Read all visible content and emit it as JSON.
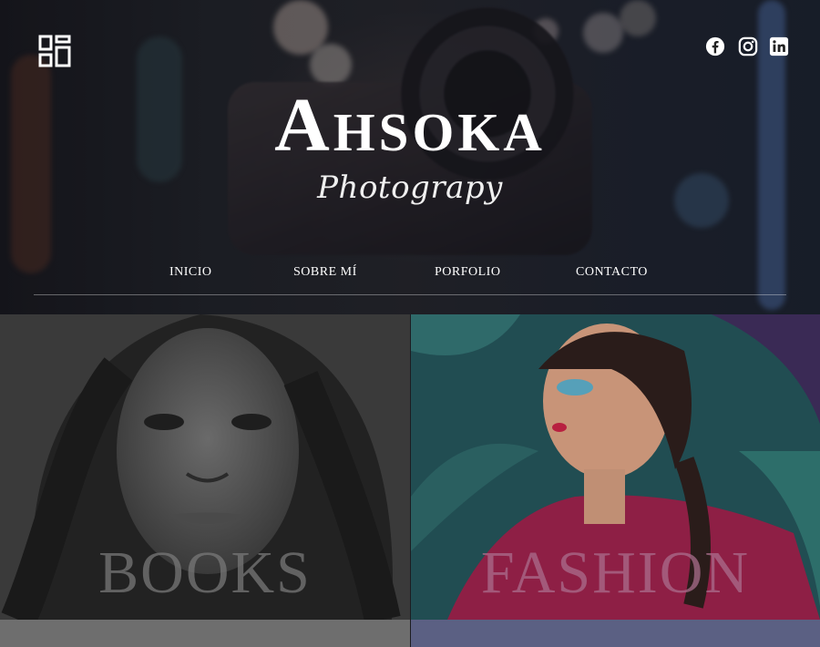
{
  "header": {
    "brand_title": "Ahsoka",
    "brand_subtitle": "Photograpy",
    "menu_icon": "grid-menu-icon",
    "social_icons": [
      "facebook-icon",
      "instagram-icon",
      "linkedin-icon"
    ]
  },
  "nav": {
    "items": [
      {
        "label": "INICIO"
      },
      {
        "label": "SOBRE MÍ"
      },
      {
        "label": "PORFOLIO"
      },
      {
        "label": "CONTACTO"
      }
    ]
  },
  "gallery": {
    "tiles": [
      {
        "label": "BOOKS"
      },
      {
        "label": "FASHION"
      }
    ]
  },
  "colors": {
    "hero_overlay": "#1c1d22",
    "text": "#ffffff",
    "books_strip": "#6e6e6e",
    "fashion_strip": "#5b6083"
  }
}
